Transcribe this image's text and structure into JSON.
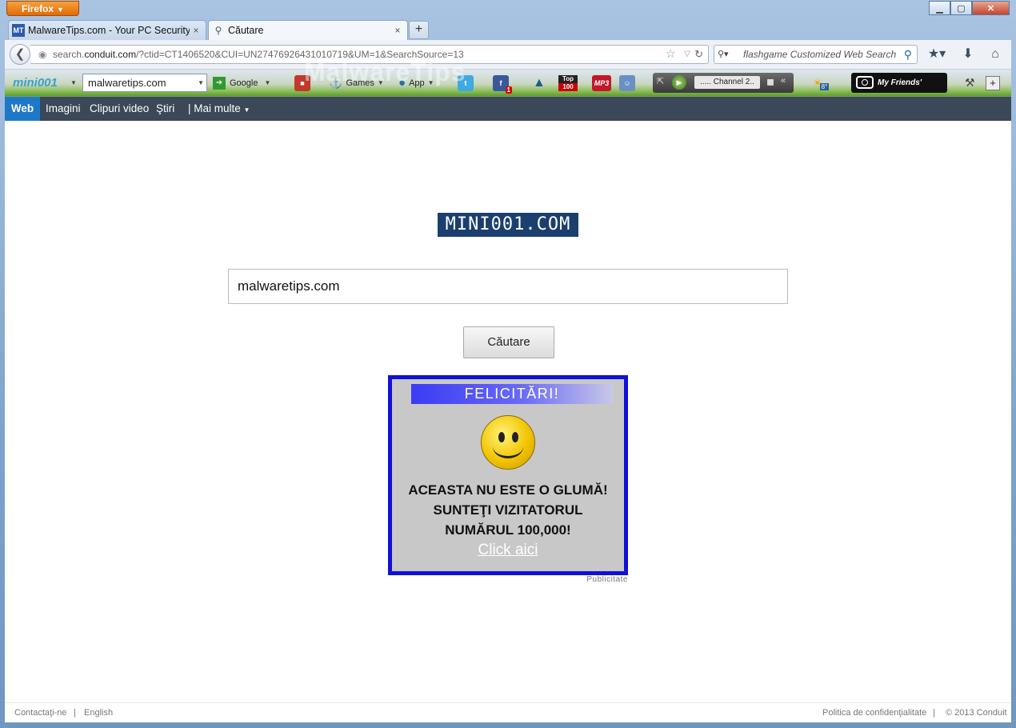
{
  "titlebar": {
    "app_button": "Firefox",
    "min": "▁",
    "max": "▢",
    "close": "✕"
  },
  "tabs": [
    {
      "favicon": "MT",
      "title": "MalwareTips.com - Your PC Security ...",
      "close": "×"
    },
    {
      "favicon": "search-icon",
      "title": "Căutare",
      "close": "×"
    }
  ],
  "new_tab": "+",
  "navbar": {
    "url_host": "search.conduit.com",
    "url_prefix": "search.",
    "url_domain": "conduit.com",
    "url_rest": "/?ctid=CT1406520&CUI=UN27476926431010719&UM=1&SearchSource=13",
    "search_placeholder": "flashgame Customized Web Search"
  },
  "toolbar": {
    "logo": "mini001",
    "search_value": "malwaretips.com",
    "engine": "Google",
    "games": "Games",
    "app": "App",
    "top100_a": "Top",
    "top100_b": "100",
    "mp3": "MP3",
    "fb_count": "1",
    "channel": "..... Channel 2..",
    "weather": "8°",
    "photos": "My Friends' Photos"
  },
  "watermark": "MalwareTips",
  "conduit_nav": {
    "web": "Web",
    "images": "Imagini",
    "videos": "Clipuri video",
    "news": "Ştiri",
    "more": "| Mai multe"
  },
  "page": {
    "logo": "MINI001.COM",
    "query": "malwaretips.com",
    "search_button": "Căutare"
  },
  "ad": {
    "banner": "FELICITĂRI!",
    "line1": "ACEASTA NU ESTE O GLUMĂ!",
    "line2": "SUNTEŢI VIZITATORUL",
    "line3": "NUMĂRUL 100,000!",
    "link": "Click aici",
    "label": "Publicitate"
  },
  "footer": {
    "contact": "Contactaţi-ne",
    "sep": "|",
    "english": "English",
    "privacy": "Politica de confidenţialitate",
    "copyright": "© 2013 Conduit"
  },
  "colors": {
    "accent": "#1e78c8",
    "ad_border": "#1010d8",
    "logo_bg": "#1b3f6e"
  }
}
